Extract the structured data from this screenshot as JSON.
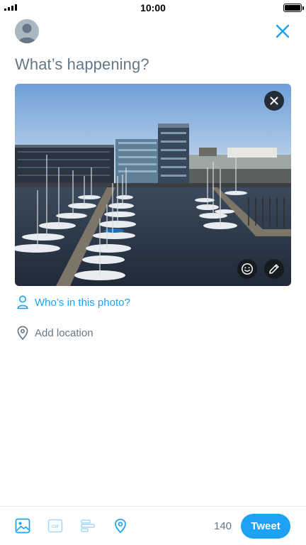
{
  "status_bar": {
    "time": "10:00",
    "signal_icon": "signal-bars-icon",
    "battery_icon": "battery-icon",
    "battery_level": 1.0
  },
  "header": {
    "avatar_icon": "default-avatar-icon",
    "close_icon": "close-icon"
  },
  "compose": {
    "placeholder": "What’s happening?"
  },
  "media": {
    "remove_icon": "close-icon",
    "stickers_icon": "smiley-icon",
    "edit_icon": "pencil-icon"
  },
  "tag_people": {
    "icon": "person-icon",
    "label": "Who’s in this photo?"
  },
  "location": {
    "icon": "location-pin-icon",
    "label": "Add location"
  },
  "toolbar": {
    "icons": [
      "image-icon",
      "gif-icon",
      "poll-icon",
      "location-pin-icon"
    ],
    "char_count": "140",
    "tweet_label": "Tweet"
  },
  "colors": {
    "accent": "#1da1f2",
    "muted_text": "#657786",
    "disabled_icon": "#a5d8f8"
  }
}
